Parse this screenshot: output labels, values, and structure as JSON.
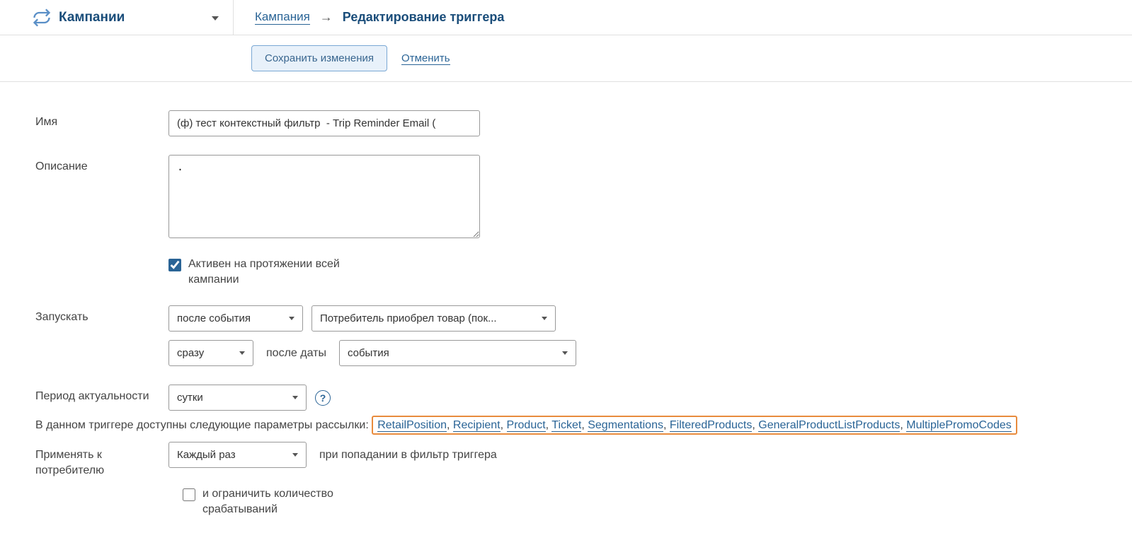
{
  "header": {
    "module_title": "Кампании"
  },
  "breadcrumb": {
    "parent": "Кампания",
    "current": "Редактирование триггера"
  },
  "actions": {
    "save": "Сохранить изменения",
    "cancel": "Отменить"
  },
  "form": {
    "name_label": "Имя",
    "name_value": "(ф) тест контекстный фильтр  - Trip Reminder Email (",
    "desc_label": "Описание",
    "desc_value": ".",
    "active_label": "Активен на протяжении всей кампании",
    "launch_label": "Запускать",
    "launch_when": "после события",
    "launch_event": "Потребитель приобрел товар (пок...",
    "launch_delay": "сразу",
    "launch_after_text": "после даты",
    "launch_after_target": "события",
    "rel_label": "Период актуальности",
    "rel_value": "сутки",
    "params_prefix": "В данном триггере доступны следующие параметры рассылки: ",
    "params": [
      "RetailPosition",
      "Recipient",
      "Product",
      "Ticket",
      "Segmentations",
      "FilteredProducts",
      "GeneralProductListProducts",
      "MultiplePromoCodes"
    ],
    "apply_label": "Применять к потребителю",
    "apply_value": "Каждый раз",
    "apply_suffix": "при попадании в фильтр триггера",
    "limit_label": "и ограничить количество срабатываний"
  }
}
